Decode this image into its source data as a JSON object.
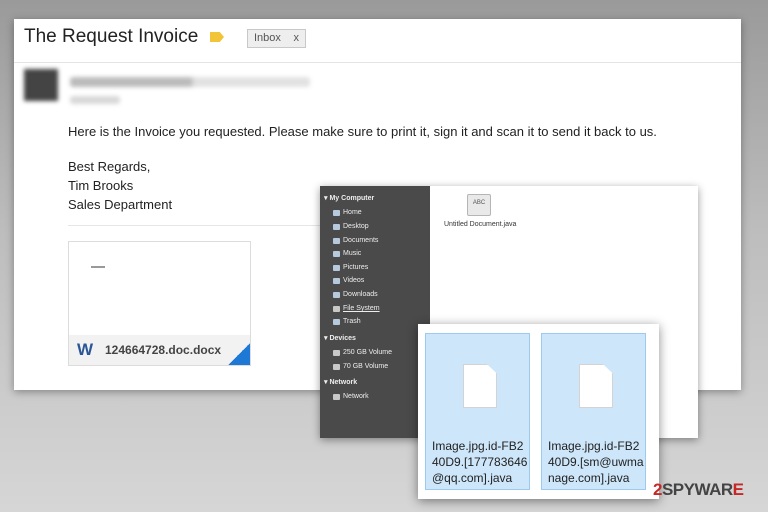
{
  "email": {
    "subject": "The Request Invoice",
    "label_chip": "Inbox",
    "label_close": "x",
    "body": "Here is the Invoice you requested. Please make sure to print it, sign it and scan it to send it back to us.",
    "signoff_lines": [
      "Best Regards,",
      "Tim Brooks",
      "Sales Department"
    ],
    "attachment": {
      "icon": "W",
      "filename": "124664728.doc.docx"
    },
    "colors": {
      "label_tag": "#f2c438",
      "word_blue": "#2b5797"
    }
  },
  "file_manager": {
    "sections": [
      {
        "title": "My Computer",
        "items": [
          "Home",
          "Desktop",
          "Documents",
          "Music",
          "Pictures",
          "Videos",
          "Downloads",
          "File System",
          "Trash"
        ]
      },
      {
        "title": "Devices",
        "items": [
          "250 GB Volume",
          "70 GB Volume"
        ]
      },
      {
        "title": "Network",
        "items": [
          "Network"
        ]
      }
    ],
    "file": {
      "icon_text": "ABC",
      "label": "Untitled Document.java"
    }
  },
  "encrypted_files": [
    {
      "name": "Image.jpg.id-FB240D9.[177783646@qq.com].java"
    },
    {
      "name": "Image.jpg.id-FB240D9.[sm@uwmanage.com].java"
    }
  ],
  "watermark": {
    "prefix": "2",
    "suffix": "SPYWAR",
    "last": "E"
  }
}
